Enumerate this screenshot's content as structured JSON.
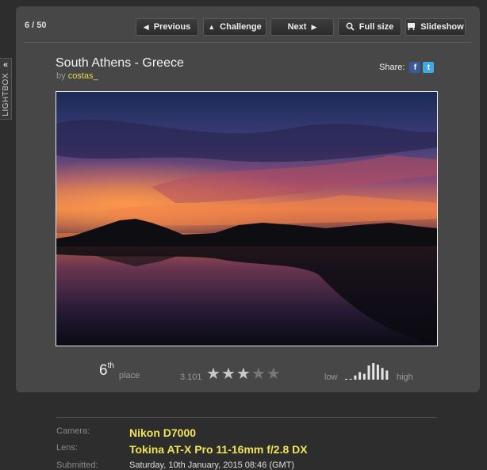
{
  "lightbox": {
    "label": "LIGHTBOX",
    "chevron": "«"
  },
  "toolbar": {
    "counter": "6 / 50",
    "previous_label": "Previous",
    "challenge_label": "Challenge",
    "next_label": "Next",
    "fullsize_label": "Full size",
    "slideshow_label": "Slideshow"
  },
  "photo": {
    "title": "South Athens - Greece",
    "by": "by",
    "author": "costas_"
  },
  "share": {
    "label": "Share:",
    "facebook": "f",
    "twitter": "t"
  },
  "stats": {
    "place_number": "6",
    "place_suffix": "th",
    "place_word": "place",
    "score": "3.101",
    "stars_filled": 3,
    "stars_total": 5,
    "low_label": "low",
    "high_label": "high",
    "histogram": [
      0.05,
      0.05,
      0.25,
      0.45,
      0.35,
      0.85,
      1.0,
      0.9,
      0.7,
      0.55
    ]
  },
  "details": {
    "camera_label": "Camera:",
    "camera_value": "Nikon D7000",
    "lens_label": "Lens:",
    "lens_value": "Tokina AT-X Pro 11-16mm f/2.8 DX",
    "submitted_label": "Submitted:",
    "submitted_value": "Saturday, 10th January, 2015 08:46 (GMT)"
  }
}
